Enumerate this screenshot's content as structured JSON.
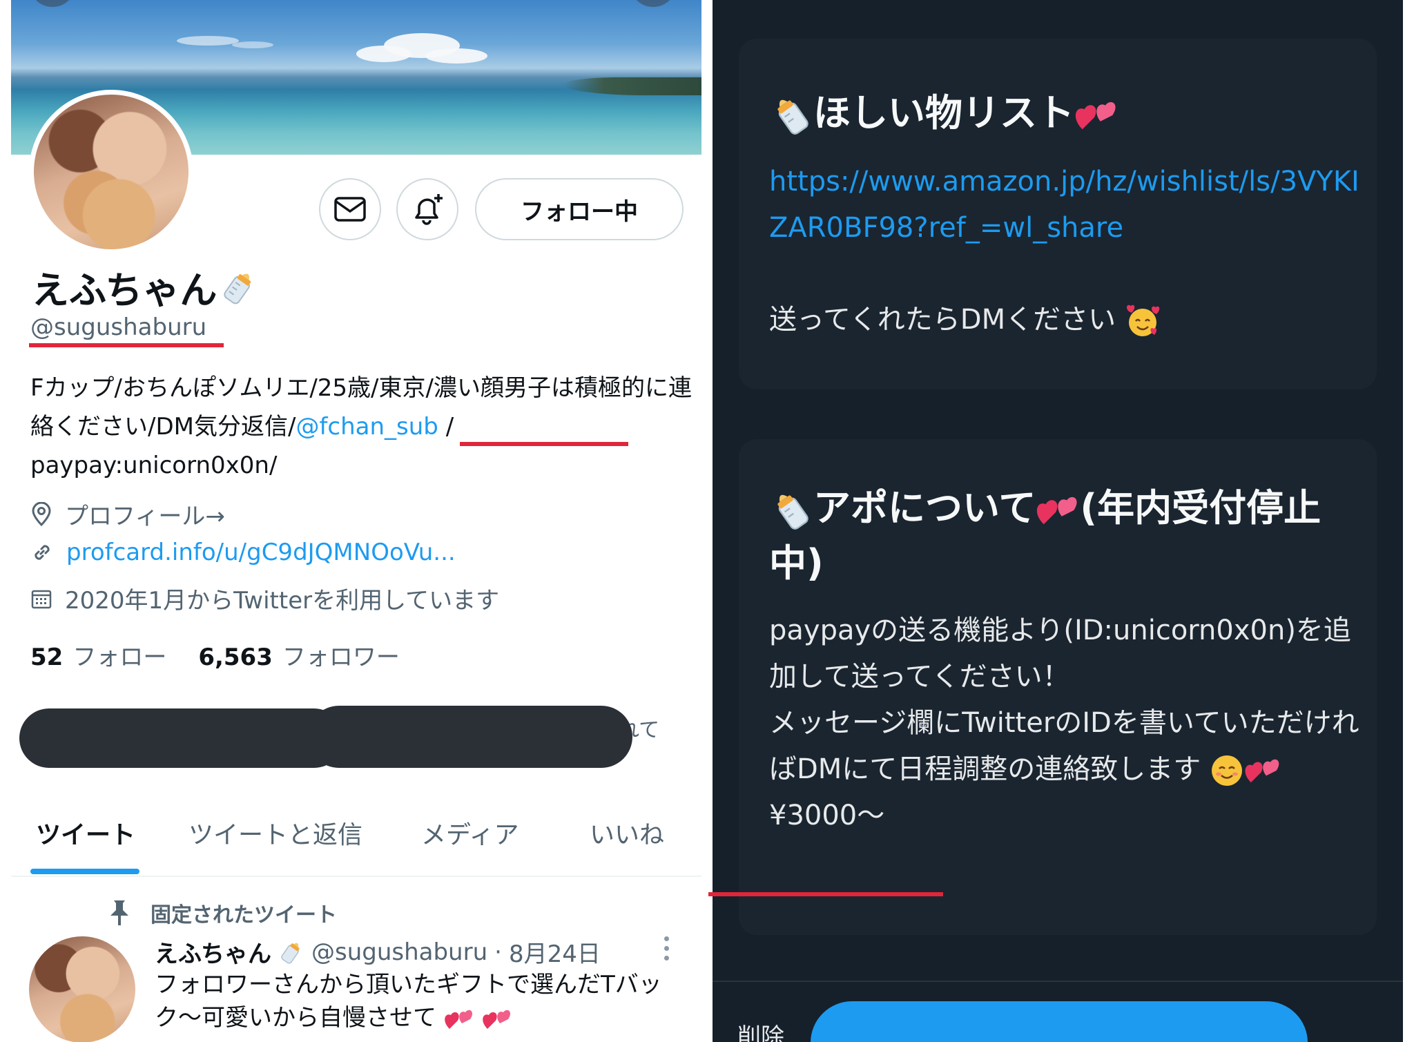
{
  "profile": {
    "display_name": "えふちゃん",
    "handle": "@sugushaburu",
    "bio_text": "Fカップ/おちんぽソムリエ/25歳/東京/濃い顔男子は積極的に連絡ください/DM気分返信/",
    "bio_mention": "@fchan_sub",
    "bio_after_mention": " /",
    "bio_paypay": "paypay:unicorn0x0n/",
    "location": "プロフィール→",
    "url": "profcard.info/u/gC9dJQMNOoVu...",
    "joined": "2020年1月からTwitterを利用しています",
    "following_count": "52",
    "following_label": "フォロー",
    "followers_count": "6,563",
    "followers_label": "フォロワー",
    "follow_button_label": "フォロー中",
    "redacted_tail": "れて"
  },
  "tabs": [
    "ツイート",
    "ツイートと返信",
    "メディア",
    "いいね"
  ],
  "pinned_tweet": {
    "pinned_label": "固定されたツイート",
    "name": "えふちゃん",
    "handle": "@sugushaburu",
    "separator": "·",
    "date": "8月24日",
    "text": "フォロワーさんから頂いたギフトで選んだTバック〜可愛いから自慢させて"
  },
  "wishlist_card": {
    "title": "ほしい物リスト",
    "link": "https://www.amazon.jp/hz/wishlist/ls/3VYKIZAR0BF98?ref_=wl_share",
    "note": "送ってくれたらDMください"
  },
  "appo_card": {
    "title": "アポについて",
    "title_suffix": "(年内受付停止中)",
    "line1": "paypayの送る機能より(ID:unicorn0x0n)を追加して送ってください！",
    "line2": "メッセージ欄にTwitterのIDを書いていただければDMにて日程調整の連絡致します",
    "price": "¥3000〜"
  },
  "bottom_left_text": "削除",
  "icons": [
    "mail-icon",
    "bell-plus-icon",
    "location-pin-icon",
    "link-icon",
    "calendar-icon",
    "pin-icon",
    "more-vertical-icon",
    "baby-bottle-emoji",
    "two-hearts-emoji",
    "smiling-hearts-emoji",
    "smiling-blush-emoji"
  ],
  "colors": {
    "accent": "#1d9bf0",
    "highlight_underline": "#e0263a",
    "dark_bg": "#15202b",
    "card_bg": "#1a2530"
  }
}
